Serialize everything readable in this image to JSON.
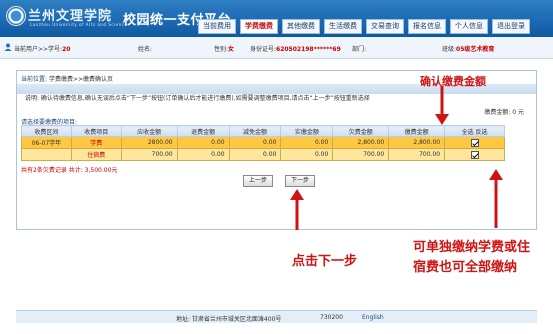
{
  "header": {
    "logo_text": "兰州文理学院",
    "logo_subtext": "Lanzhou University of Arts and Science",
    "platform_title": "校园统一支付平台",
    "nav": [
      "当前费用",
      "学费缴费",
      "其他缴费",
      "生活缴费",
      "交易查询",
      "报名信息",
      "个人信息",
      "退出登录"
    ],
    "active_nav": "学费缴费"
  },
  "infobar": {
    "user_label": "当前用户>>学号:",
    "user_value": "20",
    "name_label": "姓名:",
    "gender_label": "性别:",
    "gender_value": "女",
    "id_label": "身份证号:",
    "id_value": "620502198******69",
    "dept_label": "部门:",
    "class_label": "班级:",
    "class_value": "05级艺术教育"
  },
  "content": {
    "breadcrumb_prefix": "当前位置: ",
    "breadcrumb_path": "学费缴费>>缴费确认页",
    "notice": "说明: 确认待缴费信息,确认无误后点击“下一步”按钮(订单确认后才能进行缴费),如需要调整缴费项目,请点击“上一步”按钮重新选择",
    "paid_label": "缴费金额: ",
    "paid_value": "0 元",
    "section_title": "请选择要缴费的项目:",
    "columns": [
      "收费区间",
      "收费项目",
      "应收金额",
      "退费金额",
      "减免金额",
      "实缴金额",
      "欠费金额",
      "缴费金额",
      "全选 反选"
    ],
    "rows": [
      {
        "period": "06-07学年",
        "item": "学费",
        "receivable": "2800.00",
        "refund": "0.00",
        "reduction": "0.00",
        "paid": "0.00",
        "arrears": "2,800.00",
        "payment": "2,800.00"
      },
      {
        "period": "",
        "item": "住宿费",
        "receivable": "700.00",
        "refund": "0.00",
        "reduction": "0.00",
        "paid": "0.00",
        "arrears": "700.00",
        "payment": "700.00"
      }
    ],
    "records_text": "共有2条欠费记录  共计: 3,500.00元",
    "prev_button": "上一步",
    "next_button": "下一步"
  },
  "footer": {
    "address": "地址: 甘肃省兰州市城关区北面滩400号",
    "zip": "730200",
    "lang_link": "English"
  },
  "annotations": {
    "confirm": "确认缴费金额",
    "next_step": "点击下一步",
    "separate_line1": "可单独缴纳学费或住",
    "separate_line2": "宿费也可全部缴纳",
    "color": "#d01414"
  }
}
